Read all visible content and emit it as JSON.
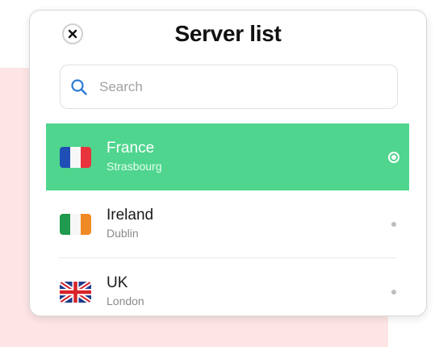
{
  "header": {
    "title": "Server list",
    "close_icon": "close-icon"
  },
  "search": {
    "placeholder": "Search",
    "value": "",
    "icon": "search-icon"
  },
  "servers": [
    {
      "country": "France",
      "city": "Strasbourg",
      "flag": "flag-france-icon",
      "selected": true
    },
    {
      "country": "Ireland",
      "city": "Dublin",
      "flag": "flag-ireland-icon",
      "selected": false
    },
    {
      "country": "UK",
      "city": "London",
      "flag": "flag-uk-icon",
      "selected": false
    }
  ],
  "colors": {
    "selected_row": "#4fd58e",
    "background_panel": "#fde5e5",
    "search_icon": "#2b7bd8"
  }
}
